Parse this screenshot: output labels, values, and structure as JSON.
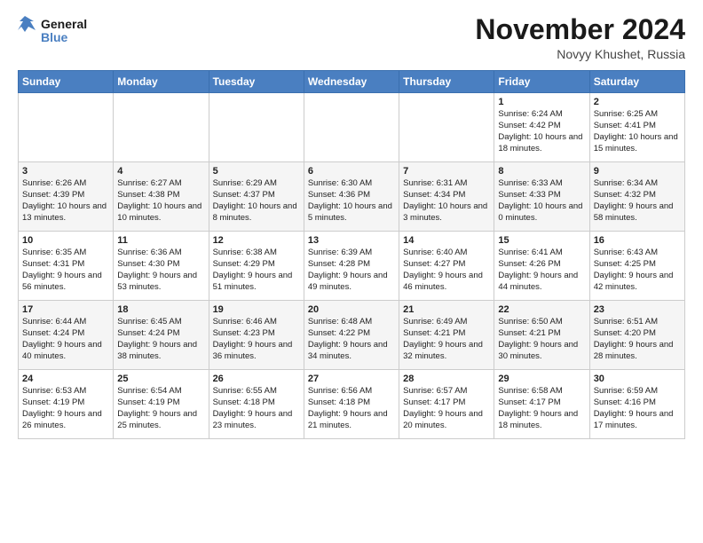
{
  "header": {
    "logo_line1": "General",
    "logo_line2": "Blue",
    "month": "November 2024",
    "location": "Novyy Khushet, Russia"
  },
  "weekdays": [
    "Sunday",
    "Monday",
    "Tuesday",
    "Wednesday",
    "Thursday",
    "Friday",
    "Saturday"
  ],
  "weeks": [
    [
      {
        "day": "",
        "text": ""
      },
      {
        "day": "",
        "text": ""
      },
      {
        "day": "",
        "text": ""
      },
      {
        "day": "",
        "text": ""
      },
      {
        "day": "",
        "text": ""
      },
      {
        "day": "1",
        "text": "Sunrise: 6:24 AM\nSunset: 4:42 PM\nDaylight: 10 hours and 18 minutes."
      },
      {
        "day": "2",
        "text": "Sunrise: 6:25 AM\nSunset: 4:41 PM\nDaylight: 10 hours and 15 minutes."
      }
    ],
    [
      {
        "day": "3",
        "text": "Sunrise: 6:26 AM\nSunset: 4:39 PM\nDaylight: 10 hours and 13 minutes."
      },
      {
        "day": "4",
        "text": "Sunrise: 6:27 AM\nSunset: 4:38 PM\nDaylight: 10 hours and 10 minutes."
      },
      {
        "day": "5",
        "text": "Sunrise: 6:29 AM\nSunset: 4:37 PM\nDaylight: 10 hours and 8 minutes."
      },
      {
        "day": "6",
        "text": "Sunrise: 6:30 AM\nSunset: 4:36 PM\nDaylight: 10 hours and 5 minutes."
      },
      {
        "day": "7",
        "text": "Sunrise: 6:31 AM\nSunset: 4:34 PM\nDaylight: 10 hours and 3 minutes."
      },
      {
        "day": "8",
        "text": "Sunrise: 6:33 AM\nSunset: 4:33 PM\nDaylight: 10 hours and 0 minutes."
      },
      {
        "day": "9",
        "text": "Sunrise: 6:34 AM\nSunset: 4:32 PM\nDaylight: 9 hours and 58 minutes."
      }
    ],
    [
      {
        "day": "10",
        "text": "Sunrise: 6:35 AM\nSunset: 4:31 PM\nDaylight: 9 hours and 56 minutes."
      },
      {
        "day": "11",
        "text": "Sunrise: 6:36 AM\nSunset: 4:30 PM\nDaylight: 9 hours and 53 minutes."
      },
      {
        "day": "12",
        "text": "Sunrise: 6:38 AM\nSunset: 4:29 PM\nDaylight: 9 hours and 51 minutes."
      },
      {
        "day": "13",
        "text": "Sunrise: 6:39 AM\nSunset: 4:28 PM\nDaylight: 9 hours and 49 minutes."
      },
      {
        "day": "14",
        "text": "Sunrise: 6:40 AM\nSunset: 4:27 PM\nDaylight: 9 hours and 46 minutes."
      },
      {
        "day": "15",
        "text": "Sunrise: 6:41 AM\nSunset: 4:26 PM\nDaylight: 9 hours and 44 minutes."
      },
      {
        "day": "16",
        "text": "Sunrise: 6:43 AM\nSunset: 4:25 PM\nDaylight: 9 hours and 42 minutes."
      }
    ],
    [
      {
        "day": "17",
        "text": "Sunrise: 6:44 AM\nSunset: 4:24 PM\nDaylight: 9 hours and 40 minutes."
      },
      {
        "day": "18",
        "text": "Sunrise: 6:45 AM\nSunset: 4:24 PM\nDaylight: 9 hours and 38 minutes."
      },
      {
        "day": "19",
        "text": "Sunrise: 6:46 AM\nSunset: 4:23 PM\nDaylight: 9 hours and 36 minutes."
      },
      {
        "day": "20",
        "text": "Sunrise: 6:48 AM\nSunset: 4:22 PM\nDaylight: 9 hours and 34 minutes."
      },
      {
        "day": "21",
        "text": "Sunrise: 6:49 AM\nSunset: 4:21 PM\nDaylight: 9 hours and 32 minutes."
      },
      {
        "day": "22",
        "text": "Sunrise: 6:50 AM\nSunset: 4:21 PM\nDaylight: 9 hours and 30 minutes."
      },
      {
        "day": "23",
        "text": "Sunrise: 6:51 AM\nSunset: 4:20 PM\nDaylight: 9 hours and 28 minutes."
      }
    ],
    [
      {
        "day": "24",
        "text": "Sunrise: 6:53 AM\nSunset: 4:19 PM\nDaylight: 9 hours and 26 minutes."
      },
      {
        "day": "25",
        "text": "Sunrise: 6:54 AM\nSunset: 4:19 PM\nDaylight: 9 hours and 25 minutes."
      },
      {
        "day": "26",
        "text": "Sunrise: 6:55 AM\nSunset: 4:18 PM\nDaylight: 9 hours and 23 minutes."
      },
      {
        "day": "27",
        "text": "Sunrise: 6:56 AM\nSunset: 4:18 PM\nDaylight: 9 hours and 21 minutes."
      },
      {
        "day": "28",
        "text": "Sunrise: 6:57 AM\nSunset: 4:17 PM\nDaylight: 9 hours and 20 minutes."
      },
      {
        "day": "29",
        "text": "Sunrise: 6:58 AM\nSunset: 4:17 PM\nDaylight: 9 hours and 18 minutes."
      },
      {
        "day": "30",
        "text": "Sunrise: 6:59 AM\nSunset: 4:16 PM\nDaylight: 9 hours and 17 minutes."
      }
    ]
  ]
}
